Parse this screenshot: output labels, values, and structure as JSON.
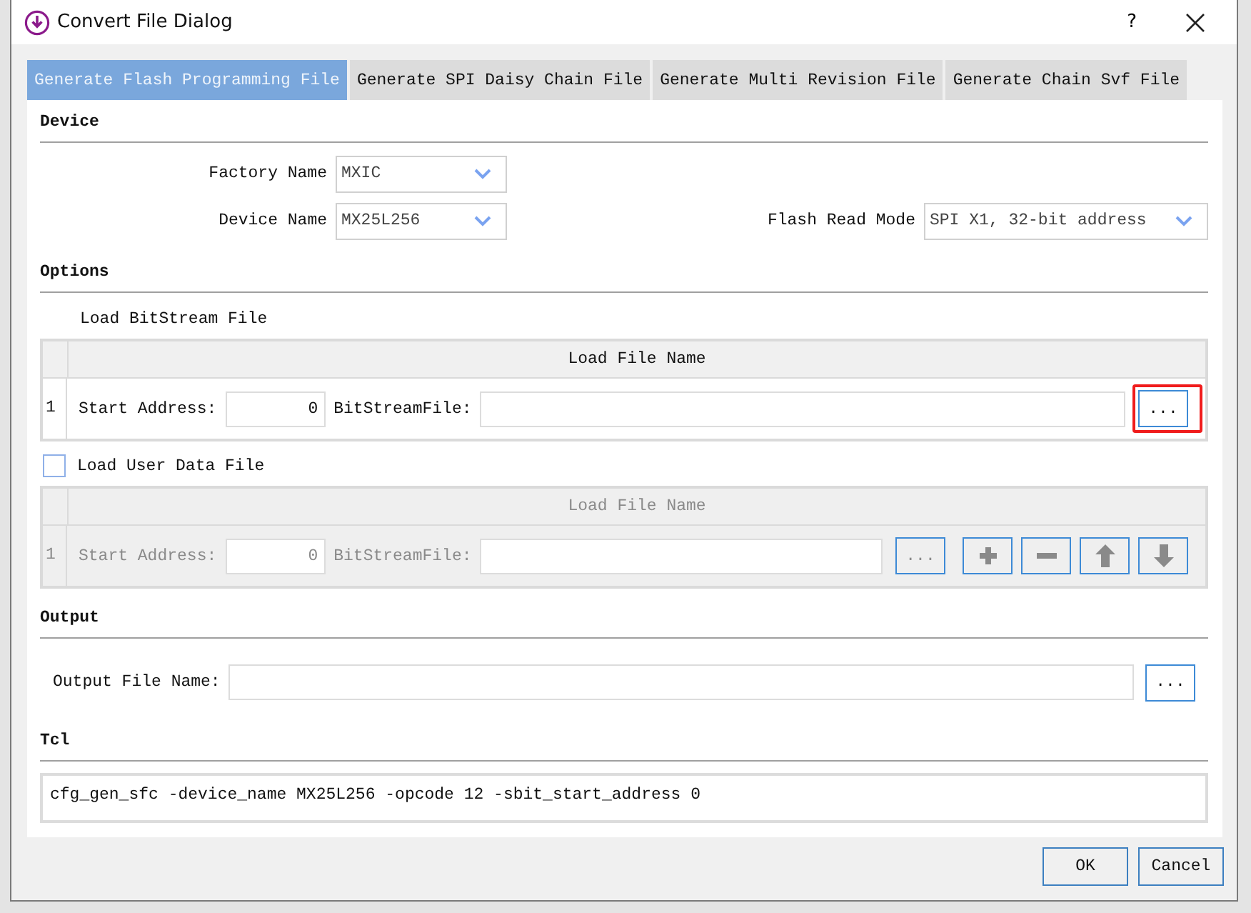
{
  "window": {
    "title": "Convert File Dialog",
    "help": "?"
  },
  "tabs": [
    {
      "label": "Generate Flash Programming File",
      "selected": true
    },
    {
      "label": "Generate SPI Daisy Chain File",
      "selected": false
    },
    {
      "label": "Generate Multi Revision File",
      "selected": false
    },
    {
      "label": "Generate Chain Svf File",
      "selected": false
    }
  ],
  "device": {
    "heading": "Device",
    "factory_name": {
      "label": "Factory Name",
      "value": "MXIC"
    },
    "device_name": {
      "label": "Device Name",
      "value": "MX25L256"
    },
    "flash_read_mode": {
      "label": "Flash Read Mode",
      "value": "SPI X1, 32-bit address"
    }
  },
  "options": {
    "heading": "Options",
    "bitstream": {
      "label": "Load BitStream File",
      "header": "Load File Name",
      "disabled": false,
      "rows": [
        {
          "index": "1",
          "start_label": "Start Address:",
          "start_value": "0",
          "file_label": "BitStreamFile:",
          "highlighted": true,
          "buttons": [
            {
              "kind": "browse",
              "label": "..."
            }
          ]
        }
      ]
    },
    "user_data": {
      "label": "Load User Data File",
      "checked": false,
      "header": "Load File Name",
      "disabled": true,
      "rows": [
        {
          "index": "1",
          "start_label": "Start Address:",
          "start_value": "0",
          "file_label": "BitStreamFile:",
          "highlighted": false,
          "buttons": [
            {
              "kind": "browse",
              "label": "..."
            },
            {
              "kind": "add"
            },
            {
              "kind": "remove"
            },
            {
              "kind": "up"
            },
            {
              "kind": "down"
            }
          ]
        }
      ]
    }
  },
  "output": {
    "heading": "Output",
    "label": "Output File Name:",
    "browse": "..."
  },
  "tcl": {
    "heading": "Tcl",
    "command": "cfg_gen_sfc -device_name MX25L256 -opcode 12 -sbit_start_address 0"
  },
  "buttons": [
    {
      "label": "OK"
    },
    {
      "label": "Cancel"
    }
  ]
}
